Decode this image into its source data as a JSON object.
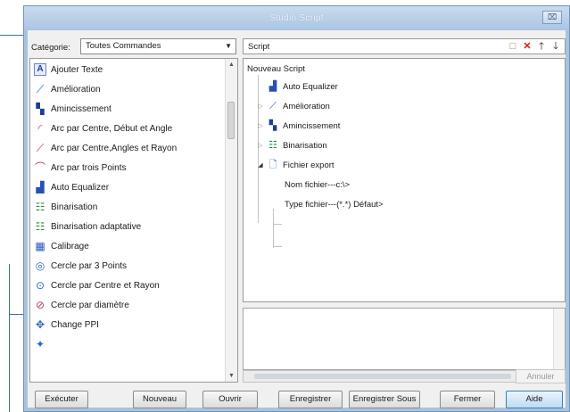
{
  "window": {
    "title": "Studio Script",
    "close_glyph": "⌧"
  },
  "category": {
    "label": "Catégorie:",
    "selected": "Toutes Commandes"
  },
  "commands": [
    {
      "label": "Ajouter Texte",
      "icon": "text-A-icon"
    },
    {
      "label": "Amélioration",
      "icon": "wand-icon"
    },
    {
      "label": "Amincissement",
      "icon": "thinning-icon"
    },
    {
      "label": "Arc par Centre, Début et Angle",
      "icon": "arc-icon"
    },
    {
      "label": "Arc par Centre,Angles et Rayon",
      "icon": "arc-icon"
    },
    {
      "label": "Arc par trois Points",
      "icon": "arc-icon"
    },
    {
      "label": "Auto Equalizer",
      "icon": "equalizer-icon"
    },
    {
      "label": "Binarisation",
      "icon": "binarization-icon"
    },
    {
      "label": "Binarisation adaptative",
      "icon": "binarization-icon"
    },
    {
      "label": "Calibrage",
      "icon": "calibration-icon"
    },
    {
      "label": "Cercle par 3 Points",
      "icon": "circle-icon"
    },
    {
      "label": "Cercle par Centre et Rayon",
      "icon": "circle-icon"
    },
    {
      "label": "Cercle par diamètre",
      "icon": "circle-icon"
    },
    {
      "label": "Change PPI",
      "icon": "ppi-icon"
    },
    {
      "label": "",
      "icon": "partial-icon"
    }
  ],
  "script": {
    "label": "Script",
    "root": "Nouveau Script",
    "nodes": [
      {
        "label": "Auto Equalizer",
        "icon": "equalizer-icon"
      },
      {
        "label": "Amélioration",
        "icon": "wand-icon"
      },
      {
        "label": "Amincissement",
        "icon": "thinning-icon"
      },
      {
        "label": "Binarisation",
        "icon": "binarization-icon"
      },
      {
        "label": "Fichier export",
        "icon": "file-export-icon"
      }
    ],
    "params": [
      {
        "label": "Nom fichier---c:\\>"
      },
      {
        "label": "Type fichier---(*.*) Défaut>"
      }
    ],
    "undo_label": "Annuler"
  },
  "buttons": {
    "execute": "Exécuter",
    "new": "Nouveau",
    "open": "Ouvrir",
    "save": "Enregistrer",
    "save_as": "Enregistrer Sous",
    "close": "Fermer",
    "help": "Aide"
  }
}
